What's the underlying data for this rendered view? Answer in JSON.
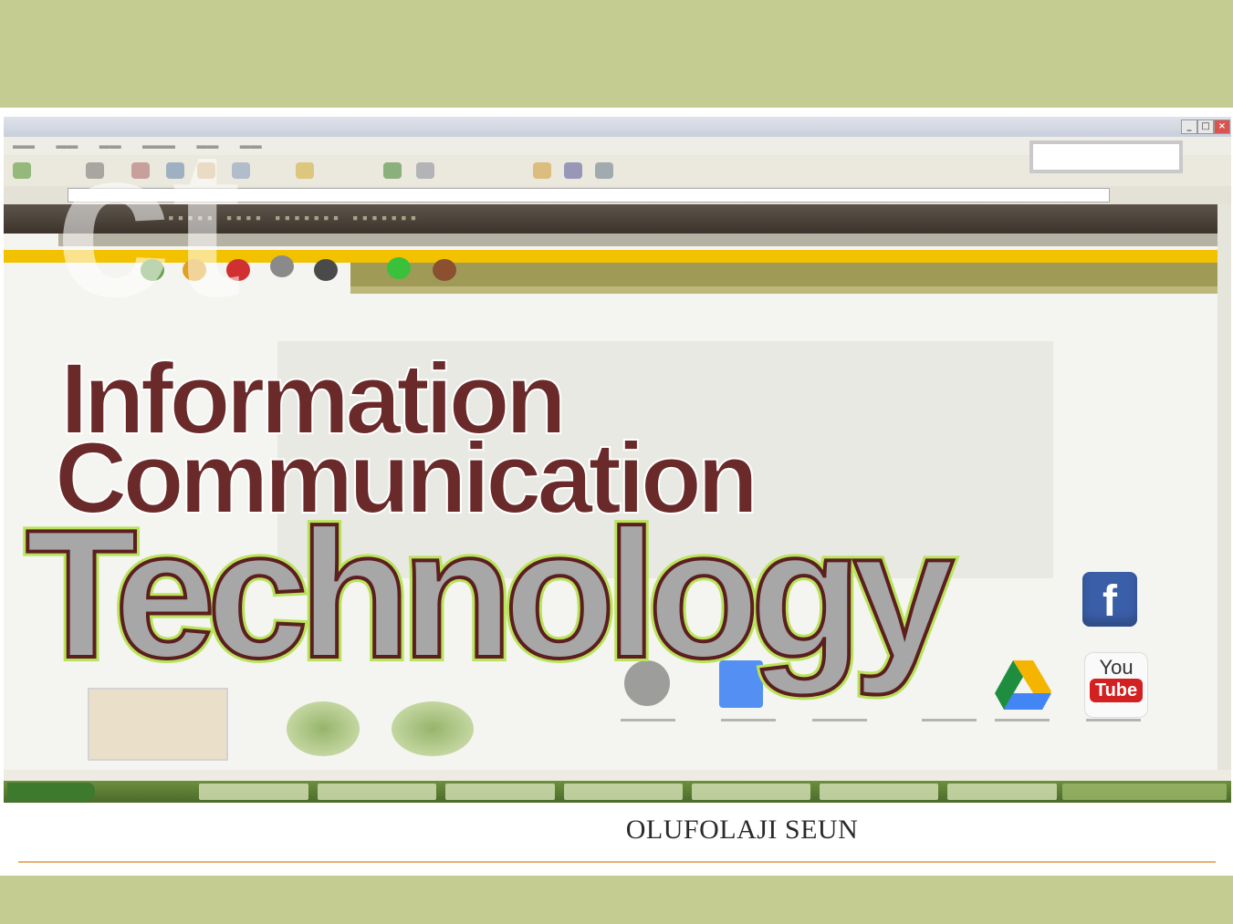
{
  "slide": {
    "colors": {
      "band": "#c5cc92",
      "rule": "#e8b071",
      "title_dark": "#6b2a2a",
      "technology_fill": "#a7a7a7",
      "technology_outline": "#b9e35a"
    },
    "title_lines": {
      "line1": "Information",
      "line2": "Communication",
      "line3": "Technology"
    },
    "author": "OLUFOLAJI SEUN"
  },
  "background_screenshot": {
    "browser_window": "faded browser window",
    "taskbar_color": "#4a6b2a"
  },
  "app_icons": [
    {
      "name": "drive-icon",
      "colors": [
        "#1e8e3e",
        "#f4b400",
        "#4285f4"
      ]
    },
    {
      "name": "docs-icon",
      "color": "#4285f4"
    },
    {
      "name": "facebook-icon",
      "glyph": "f",
      "color": "#3b5ea8"
    },
    {
      "name": "youtube-icon",
      "label_top": "You",
      "label_bottom": "Tube",
      "color": "#d32020"
    }
  ]
}
